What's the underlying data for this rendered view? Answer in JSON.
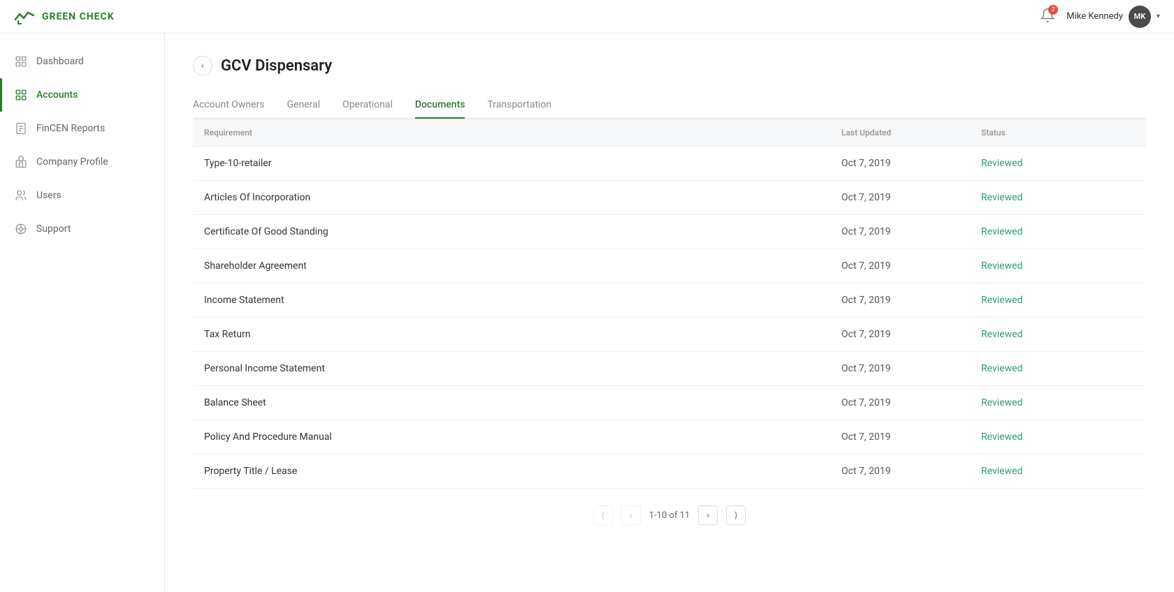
{
  "app": {
    "logo_text": "GREEN CHECK"
  },
  "topbar": {
    "notification_count": "2",
    "user_name": "Mike Kennedy",
    "user_initials": "MK"
  },
  "sidebar": {
    "items": [
      {
        "id": "dashboard",
        "label": "Dashboard",
        "active": false
      },
      {
        "id": "accounts",
        "label": "Accounts",
        "active": true
      },
      {
        "id": "fincen",
        "label": "FinCEN Reports",
        "active": false
      },
      {
        "id": "company",
        "label": "Company Profile",
        "active": false
      },
      {
        "id": "users",
        "label": "Users",
        "active": false
      },
      {
        "id": "support",
        "label": "Support",
        "active": false
      }
    ]
  },
  "page": {
    "title": "GCV Dispensary",
    "tabs": [
      {
        "id": "account-owners",
        "label": "Account Owners",
        "active": false
      },
      {
        "id": "general",
        "label": "General",
        "active": false
      },
      {
        "id": "operational",
        "label": "Operational",
        "active": false
      },
      {
        "id": "documents",
        "label": "Documents",
        "active": true
      },
      {
        "id": "transportation",
        "label": "Transportation",
        "active": false
      }
    ]
  },
  "table": {
    "columns": [
      {
        "id": "requirement",
        "label": "Requirement"
      },
      {
        "id": "last_updated",
        "label": "Last Updated"
      },
      {
        "id": "status",
        "label": "Status"
      }
    ],
    "rows": [
      {
        "requirement": "Type-10-retailer",
        "last_updated": "Oct 7, 2019",
        "status": "Reviewed"
      },
      {
        "requirement": "Articles Of Incorporation",
        "last_updated": "Oct 7, 2019",
        "status": "Reviewed"
      },
      {
        "requirement": "Certificate Of Good Standing",
        "last_updated": "Oct 7, 2019",
        "status": "Reviewed"
      },
      {
        "requirement": "Shareholder Agreement",
        "last_updated": "Oct 7, 2019",
        "status": "Reviewed"
      },
      {
        "requirement": "Income Statement",
        "last_updated": "Oct 7, 2019",
        "status": "Reviewed"
      },
      {
        "requirement": "Tax Return",
        "last_updated": "Oct 7, 2019",
        "status": "Reviewed"
      },
      {
        "requirement": "Personal Income Statement",
        "last_updated": "Oct 7, 2019",
        "status": "Reviewed"
      },
      {
        "requirement": "Balance Sheet",
        "last_updated": "Oct 7, 2019",
        "status": "Reviewed"
      },
      {
        "requirement": "Policy And Procedure Manual",
        "last_updated": "Oct 7, 2019",
        "status": "Reviewed"
      },
      {
        "requirement": "Property Title / Lease",
        "last_updated": "Oct 7, 2019",
        "status": "Reviewed"
      }
    ]
  },
  "pagination": {
    "info": "1-10 of 11",
    "first_btn": "⟨",
    "prev_btn": "‹",
    "next_btn": "›",
    "last_btn": "⟩"
  }
}
